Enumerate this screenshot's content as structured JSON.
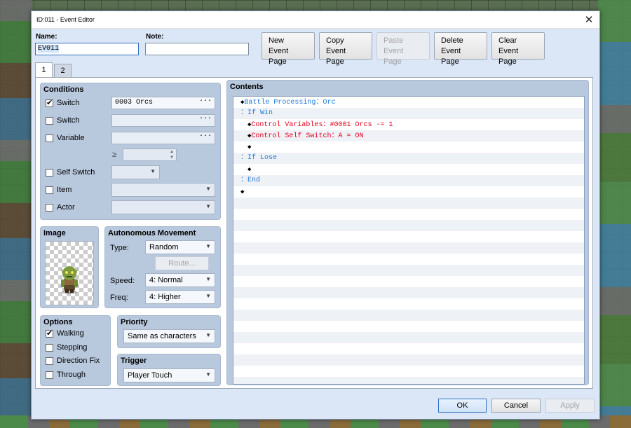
{
  "window": {
    "title": "ID:011 - Event Editor",
    "close_glyph": "✕"
  },
  "header": {
    "name_label": "Name:",
    "name_value": "EV011",
    "note_label": "Note:",
    "note_value": "",
    "buttons": [
      {
        "line1": "New",
        "line2": "Event Page",
        "enabled": true
      },
      {
        "line1": "Copy",
        "line2": "Event Page",
        "enabled": true
      },
      {
        "line1": "Paste",
        "line2": "Event Page",
        "enabled": false
      },
      {
        "line1": "Delete",
        "line2": "Event Page",
        "enabled": true
      },
      {
        "line1": "Clear",
        "line2": "Event Page",
        "enabled": true
      }
    ]
  },
  "tabs": [
    {
      "label": "1",
      "active": true
    },
    {
      "label": "2",
      "active": false
    }
  ],
  "conditions": {
    "title": "Conditions",
    "switch1": {
      "label": "Switch",
      "checked": true,
      "value": "0003 Orcs",
      "button": "···"
    },
    "switch2": {
      "label": "Switch",
      "checked": false,
      "value": "",
      "button": "···"
    },
    "variable": {
      "label": "Variable",
      "checked": false,
      "value": "",
      "button": "···",
      "gte": "≥"
    },
    "self_switch": {
      "label": "Self Switch",
      "checked": false
    },
    "item": {
      "label": "Item",
      "checked": false
    },
    "actor": {
      "label": "Actor",
      "checked": false
    }
  },
  "image": {
    "title": "Image",
    "sprite": "orc-sprite"
  },
  "movement": {
    "title": "Autonomous Movement",
    "type_label": "Type:",
    "type_value": "Random",
    "route_label": "Route...",
    "speed_label": "Speed:",
    "speed_value": "4: Normal",
    "freq_label": "Freq:",
    "freq_value": "4: Higher"
  },
  "options": {
    "title": "Options",
    "items": [
      {
        "label": "Walking",
        "checked": true
      },
      {
        "label": "Stepping",
        "checked": false
      },
      {
        "label": "Direction Fix",
        "checked": false
      },
      {
        "label": "Through",
        "checked": false
      }
    ]
  },
  "priority": {
    "title": "Priority",
    "value": "Same as characters"
  },
  "trigger": {
    "title": "Trigger",
    "value": "Player Touch"
  },
  "contents": {
    "title": "Contents",
    "lines": [
      {
        "indent": 0,
        "bullet": "◆",
        "text": "Battle Processing：Orc",
        "color": "blue"
      },
      {
        "indent": 0,
        "bullet": "：",
        "text": "If Win",
        "color": "blue"
      },
      {
        "indent": 1,
        "bullet": "◆",
        "text": "Control Variables：#0001 Orcs -= 1",
        "color": "red"
      },
      {
        "indent": 1,
        "bullet": "◆",
        "text": "Control Self Switch：A = ON",
        "color": "red"
      },
      {
        "indent": 1,
        "bullet": "◆",
        "text": "",
        "color": "black"
      },
      {
        "indent": 0,
        "bullet": "：",
        "text": "If Lose",
        "color": "blue"
      },
      {
        "indent": 1,
        "bullet": "◆",
        "text": "",
        "color": "black"
      },
      {
        "indent": 0,
        "bullet": "：",
        "text": "End",
        "color": "blue"
      },
      {
        "indent": 0,
        "bullet": "◆",
        "text": "",
        "color": "black",
        "outdent": true
      }
    ]
  },
  "footer": {
    "ok": "OK",
    "cancel": "Cancel",
    "apply": "Apply"
  },
  "colors": {
    "accent": "#2f6fc5",
    "cmd_blue": "#1e78d8",
    "cmd_red": "#e3001b",
    "panel": "#b8c8dd"
  }
}
